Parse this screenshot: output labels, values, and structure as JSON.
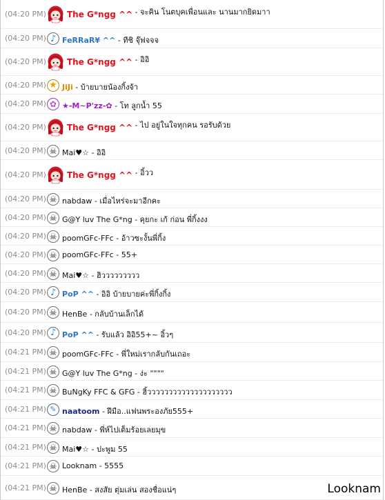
{
  "messages": [
    {
      "time": "(04:20 PM)",
      "name": "The G*ngg ^^",
      "text": " - จะคิน โนตบุคเพื่อนและ นานมากยิดมาา",
      "avatar": "girl-avatar-icon",
      "style": "red"
    },
    {
      "time": "(04:20 PM)",
      "name": "FeRRaR¥ ^^",
      "text": " - ทีชิ จุ๊ฟจจจ",
      "avatar": "music-note-icon",
      "style": "blue"
    },
    {
      "time": "(04:20 PM)",
      "name": "The G*ngg ^^",
      "text": " - อิอิ",
      "avatar": "girl-avatar-icon",
      "style": "red"
    },
    {
      "time": "(04:20 PM)",
      "name": "JiJi",
      "text": " - บ้ายบายน้องกิ้งจ้า",
      "avatar": "star-icon",
      "style": "orange"
    },
    {
      "time": "(04:20 PM)",
      "name": "★-M~P'zz-✿",
      "text": " - โท ลูกน้ำ 55",
      "avatar": "flower-icon",
      "style": "purple"
    },
    {
      "time": "(04:20 PM)",
      "name": "The G*ngg ^^",
      "text": " - ไป อยู่ในใจทุกคน รอรับด้วย",
      "avatar": "girl-avatar-icon",
      "style": "red"
    },
    {
      "time": "(04:20 PM)",
      "name": "Mai♥☆",
      "text": " - อิอิ",
      "avatar": "skull-icon",
      "style": "plain"
    },
    {
      "time": "(04:20 PM)",
      "name": "The G*ngg ^^",
      "text": " - อิ้วว",
      "avatar": "girl-avatar-icon",
      "style": "red"
    },
    {
      "time": "(04:20 PM)",
      "name": "nabdaw",
      "text": " - เมื่อไหร่จะมาอีกคะ",
      "avatar": "skull-icon",
      "style": "plain"
    },
    {
      "time": "(04:20 PM)",
      "name": "G@Y luv The G*ng",
      "text": " - คุยกะ เก้ ก่อน พี่กิ้งงง",
      "avatar": "skull-icon",
      "style": "plain"
    },
    {
      "time": "(04:20 PM)",
      "name": "poomGFc-FFc",
      "text": " - อ้าวซะงั้นพี่กิ้ง",
      "avatar": "skull-icon",
      "style": "plain"
    },
    {
      "time": "(04:20 PM)",
      "name": "poomGFc-FFc",
      "text": " - 55+",
      "avatar": "skull-icon",
      "style": "plain"
    },
    {
      "time": "(04:20 PM)",
      "name": "Mai♥☆",
      "text": " - ฮิววววววววว",
      "avatar": "skull-icon",
      "style": "plain"
    },
    {
      "time": "(04:20 PM)",
      "name": "PoP ^^",
      "text": " - อิอิ บ้ายบายค่ะพี่กิ้งกิ้ง",
      "avatar": "music-note-icon",
      "style": "blue"
    },
    {
      "time": "(04:20 PM)",
      "name": "HenBe",
      "text": " - กลับบ้านเล็กได้",
      "avatar": "skull-icon",
      "style": "plain"
    },
    {
      "time": "(04:20 PM)",
      "name": "PoP ^^",
      "text": " - รับแล้ว อิอิ55+~ อิ้วๆ",
      "avatar": "music-note-icon",
      "style": "blue"
    },
    {
      "time": "(04:21 PM)",
      "name": "poomGFc-FFc",
      "text": " - พี่ใหม่เรากลับกันเถอะ",
      "avatar": "skull-icon",
      "style": "plain"
    },
    {
      "time": "(04:21 PM)",
      "name": "G@Y luv The G*ng",
      "text": " - ง่ะ \"\"\"\"",
      "avatar": "skull-icon",
      "style": "plain"
    },
    {
      "time": "(04:21 PM)",
      "name": "BuNgKy FFC & GFG",
      "text": " - ฮิ้วววววววววววววววววววว",
      "avatar": "skull-icon",
      "style": "plain"
    },
    {
      "time": "(04:21 PM)",
      "name": "naatoom",
      "text": " - ฝีมือ..แฟนพระองภัย555+",
      "avatar": "pen-icon",
      "style": "navy"
    },
    {
      "time": "(04:21 PM)",
      "name": "nabdaw",
      "text": " - พี่ห์ไปเต็มร้อยเลยมุข",
      "avatar": "skull-icon",
      "style": "plain"
    },
    {
      "time": "(04:21 PM)",
      "name": "Mai♥☆",
      "text": " - ปะพูม 55",
      "avatar": "skull-icon",
      "style": "plain"
    },
    {
      "time": "(04:21 PM)",
      "name": "Looknam",
      "text": " - 5555",
      "avatar": "skull-icon",
      "style": "plain"
    },
    {
      "time": "(04:21 PM)",
      "name": "HenBe",
      "text": " - สงสัย ตุ่มเล่น สองชื่อแน่ๆ",
      "avatar": "skull-icon",
      "style": "plain"
    }
  ],
  "watermark": "Looknam"
}
